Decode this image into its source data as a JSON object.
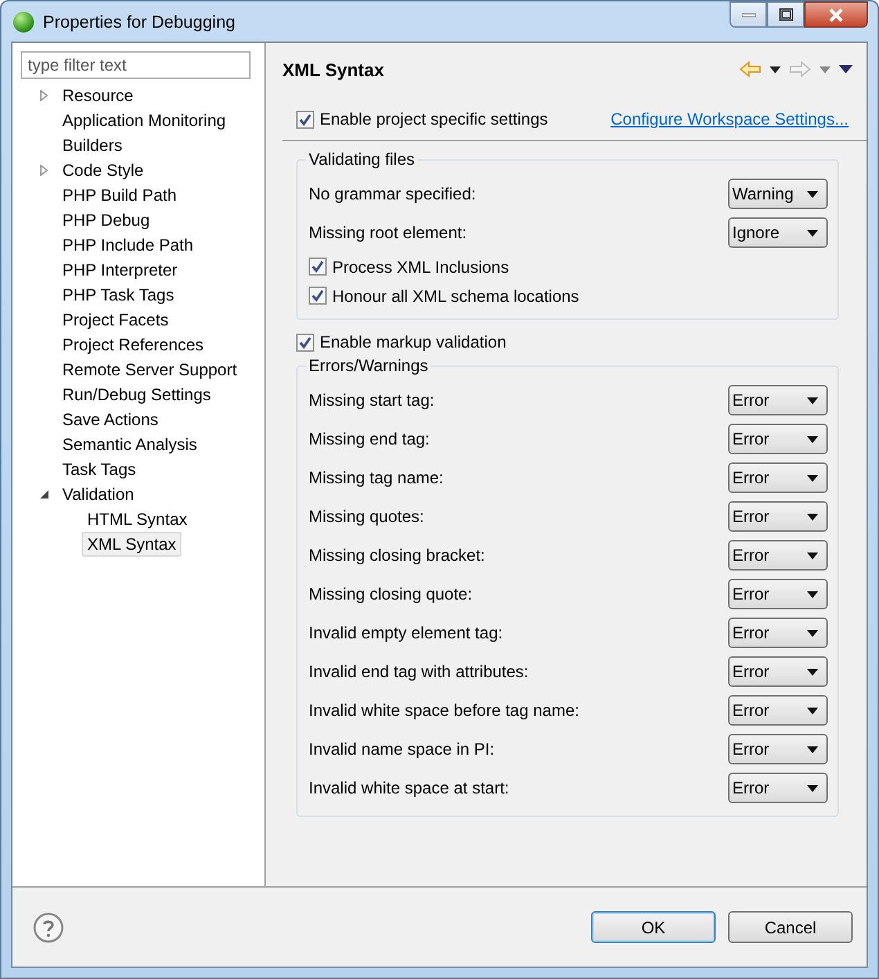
{
  "window": {
    "title": "Properties for Debugging"
  },
  "filter": {
    "placeholder": "type filter text"
  },
  "tree": [
    {
      "label": "Resource",
      "expanded": false,
      "selected": false
    },
    {
      "label": "Application Monitoring",
      "selected": false
    },
    {
      "label": "Builders",
      "selected": false
    },
    {
      "label": "Code Style",
      "expanded": false,
      "selected": false
    },
    {
      "label": "PHP Build Path",
      "selected": false
    },
    {
      "label": "PHP Debug",
      "selected": false
    },
    {
      "label": "PHP Include Path",
      "selected": false
    },
    {
      "label": "PHP Interpreter",
      "selected": false
    },
    {
      "label": "PHP Task Tags",
      "selected": false
    },
    {
      "label": "Project Facets",
      "selected": false
    },
    {
      "label": "Project References",
      "selected": false
    },
    {
      "label": "Remote Server Support",
      "selected": false
    },
    {
      "label": "Run/Debug Settings",
      "selected": false
    },
    {
      "label": "Save Actions",
      "selected": false
    },
    {
      "label": "Semantic Analysis",
      "selected": false
    },
    {
      "label": "Task Tags",
      "selected": false
    },
    {
      "label": "Validation",
      "expanded": true,
      "selected": false,
      "children": [
        {
          "label": "HTML Syntax",
          "selected": false
        },
        {
          "label": "XML Syntax",
          "selected": true
        }
      ]
    }
  ],
  "page": {
    "title": "XML Syntax",
    "project_specific": {
      "label": "Enable project specific settings",
      "checked": true
    },
    "workspace_link": "Configure Workspace Settings...",
    "validating_files": {
      "title": "Validating files",
      "items": [
        {
          "kind": "select",
          "label": "No grammar specified:",
          "value": "Warning"
        },
        {
          "kind": "select",
          "label": "Missing root element:",
          "value": "Ignore"
        },
        {
          "kind": "check",
          "label": "Process XML Inclusions",
          "checked": true
        },
        {
          "kind": "check",
          "label": "Honour all XML schema locations",
          "checked": true
        }
      ]
    },
    "markup_validation": {
      "label": "Enable markup validation",
      "checked": true
    },
    "errors_warnings": {
      "title": "Errors/Warnings",
      "items": [
        {
          "kind": "select",
          "label": "Missing start tag:",
          "value": "Error"
        },
        {
          "kind": "select",
          "label": "Missing end tag:",
          "value": "Error"
        },
        {
          "kind": "select",
          "label": "Missing tag name:",
          "value": "Error"
        },
        {
          "kind": "select",
          "label": "Missing quotes:",
          "value": "Error"
        },
        {
          "kind": "select",
          "label": "Missing closing bracket:",
          "value": "Error"
        },
        {
          "kind": "select",
          "label": "Missing closing quote:",
          "value": "Error"
        },
        {
          "kind": "select",
          "label": "Invalid empty element tag:",
          "value": "Error"
        },
        {
          "kind": "select",
          "label": "Invalid end tag with attributes:",
          "value": "Error"
        },
        {
          "kind": "select",
          "label": "Invalid white space before tag name:",
          "value": "Error"
        },
        {
          "kind": "select",
          "label": "Invalid name space in PI:",
          "value": "Error"
        },
        {
          "kind": "select",
          "label": "Invalid white space at start:",
          "value": "Error"
        }
      ]
    }
  },
  "buttons": [
    "OK",
    "Cancel"
  ]
}
